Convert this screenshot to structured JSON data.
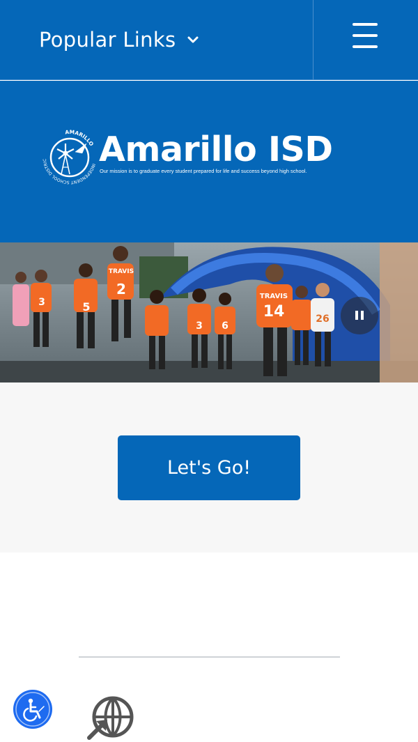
{
  "header": {
    "popular_links_label": "Popular Links",
    "dropdown_icon": "chevron-down-icon",
    "menu_icon": "hamburger-menu-icon"
  },
  "brand": {
    "name": "Amarillo ISD",
    "tagline": "Our mission is to graduate every student prepared for life and success beyond high school.",
    "seal_top_text": "AMARILLO",
    "seal_ring_text": "INDEPENDENT SCHOOL DISTRICT"
  },
  "hero": {
    "jersey_numbers": [
      "3",
      "5",
      "2",
      "3",
      "6",
      "14",
      "26"
    ],
    "jersey_name": "TRAVIS",
    "pause_icon": "pause-icon"
  },
  "cta": {
    "label": "Let's Go!"
  },
  "footer": {
    "accessibility_icon": "accessibility-icon",
    "translate_icon": "translate-globe-icon"
  },
  "colors": {
    "brand_blue": "#0567b8",
    "jersey_orange": "#f26a25",
    "accessibility_blue": "#1e6bf0"
  }
}
